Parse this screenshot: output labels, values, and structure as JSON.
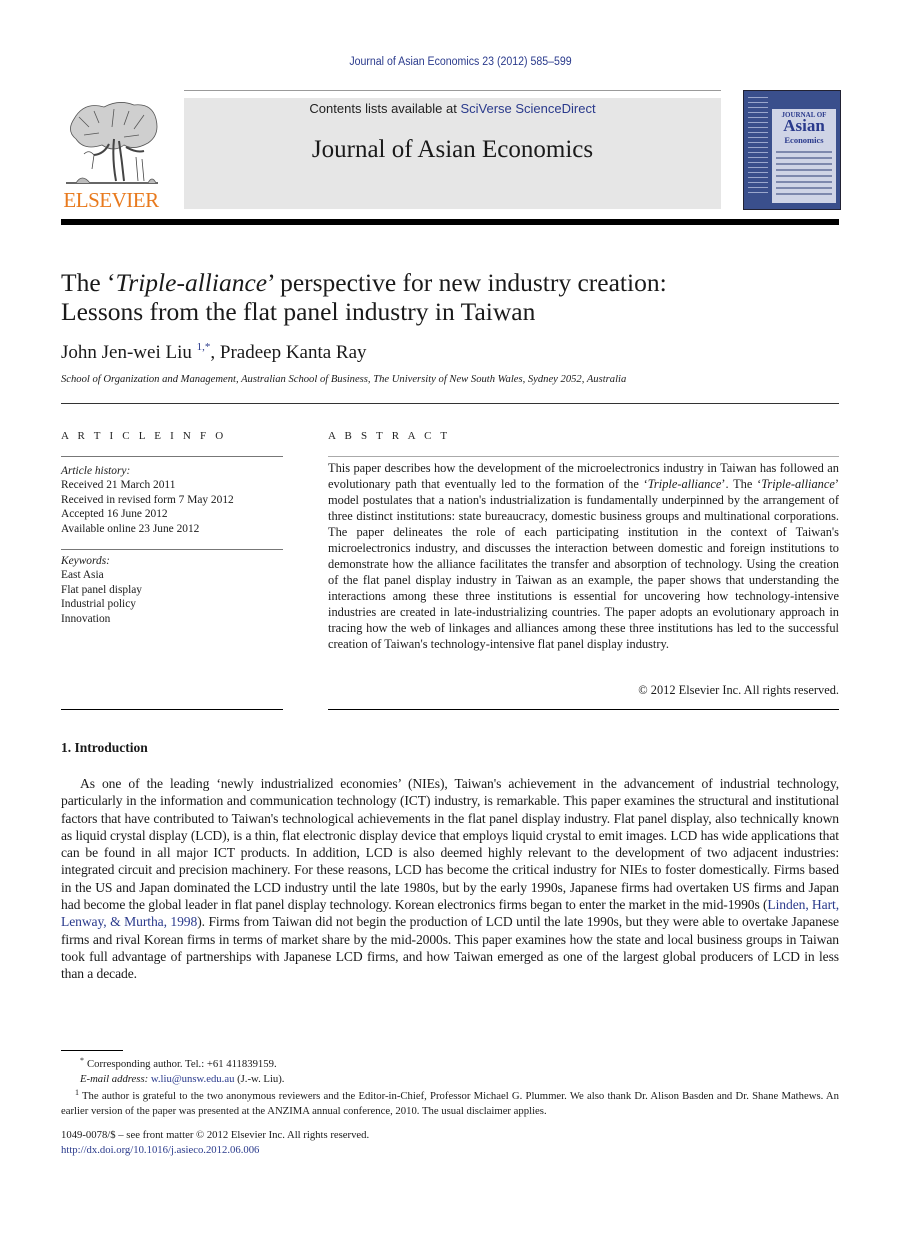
{
  "header": {
    "journal_reference": "Journal of Asian Economics 23 (2012) 585–599",
    "contents_prefix": "Contents lists available at ",
    "contents_link": "SciVerse ScienceDirect",
    "journal_name": "Journal of Asian Economics",
    "publisher": "ELSEVIER",
    "cover": {
      "line1": "JOURNAL OF",
      "line2": "Asian",
      "line3": "Economics"
    },
    "colors": {
      "link": "#2a3a8c",
      "publisher_orange": "#e87a1e",
      "banner_bg": "#e6e6e6"
    }
  },
  "article": {
    "title_prefix": "The ‘",
    "title_italic": "Triple-alliance",
    "title_suffix_line1": "’ perspective for new industry creation:",
    "title_line2": "Lessons from the flat panel industry in Taiwan",
    "author1": "John Jen-wei Liu",
    "author1_marks": "1,*",
    "author_separator": ", ",
    "author2": "Pradeep Kanta Ray",
    "affiliation": "School of Organization and Management, Australian School of Business, The University of New South Wales, Sydney 2052, Australia"
  },
  "article_info": {
    "label": "A R T I C L E   I N F O",
    "history_heading": "Article history:",
    "history": [
      "Received 21 March 2011",
      "Received in revised form 7 May 2012",
      "Accepted 16 June 2012",
      "Available online 23 June 2012"
    ],
    "keywords_heading": "Keywords:",
    "keywords": [
      "East Asia",
      "Flat panel display",
      "Industrial policy",
      "Innovation"
    ]
  },
  "abstract": {
    "label": "A B S T R A C T",
    "seg1": "This paper describes how the development of the microelectronics industry in Taiwan has followed an evolutionary path that eventually led to the formation of the ‘",
    "italic1": "Triple-alliance",
    "seg2": "’. The ‘",
    "italic2": "Triple-alliance",
    "seg3": "’ model postulates that a nation's industrialization is fundamentally underpinned by the arrangement of three distinct institutions: state bureaucracy, domestic business groups and multinational corporations. The paper delineates the role of each participating institution in the context of Taiwan's microelectronics industry, and discusses the interaction between domestic and foreign institutions to demonstrate how the alliance facilitates the transfer and absorption of technology. Using the creation of the flat panel display industry in Taiwan as an example, the paper shows that understanding the interactions among these three institutions is essential for uncovering how technology-intensive industries are created in late-industrializing countries. The paper adopts an evolutionary approach in tracing how the web of linkages and alliances among these three institutions has led to the successful creation of Taiwan's technology-intensive flat panel display industry.",
    "copyright": "© 2012 Elsevier Inc. All rights reserved."
  },
  "introduction": {
    "heading": "1.  Introduction",
    "para_before_cite": "As one of the leading ‘newly industrialized economies’ (NIEs), Taiwan's achievement in the advancement of industrial technology, particularly in the information and communication technology (ICT) industry, is remarkable. This paper examines the structural and institutional factors that have contributed to Taiwan's technological achievements in the flat panel display industry. Flat panel display, also technically known as liquid crystal display (LCD), is a thin, flat electronic display device that employs liquid crystal to emit images. LCD has wide applications that can be found in all major ICT products. In addition, LCD is also deemed highly relevant to the development of two adjacent industries: integrated circuit and precision machinery. For these reasons, LCD has become the critical industry for NIEs to foster domestically. Firms based in the US and Japan dominated the LCD industry until the late 1980s, but by the early 1990s, Japanese firms had overtaken US firms and Japan had become the global leader in flat panel display technology. Korean electronics firms began to enter the market in the mid-1990s (",
    "citation": "Linden, Hart, Lenway, & Murtha, 1998",
    "para_after_cite": "). Firms from Taiwan did not begin the production of LCD until the late 1990s, but they were able to overtake Japanese firms and rival Korean firms in terms of market share by the mid-2000s. This paper examines how the state and local business groups in Taiwan took full advantage of partnerships with Japanese LCD firms, and how Taiwan emerged as one of the largest global producers of LCD in less than a decade."
  },
  "footnotes": {
    "corresponding_mark": "*",
    "corresponding": "Corresponding author. Tel.: +61 411839159.",
    "email_label": "E-mail address:",
    "email": "w.liu@unsw.edu.au",
    "email_suffix": " (J.-w. Liu).",
    "note1_mark": "1",
    "note1": "The author is grateful to the two anonymous reviewers and the Editor-in-Chief, Professor Michael G. Plummer. We also thank Dr. Alison Basden and Dr. Shane Mathews. An earlier version of the paper was presented at the ANZIMA annual conference, 2010. The usual disclaimer applies."
  },
  "front_matter": {
    "issn_line": "1049-0078/$ – see front matter © 2012 Elsevier Inc. All rights reserved.",
    "doi": "http://dx.doi.org/10.1016/j.asieco.2012.06.006"
  }
}
